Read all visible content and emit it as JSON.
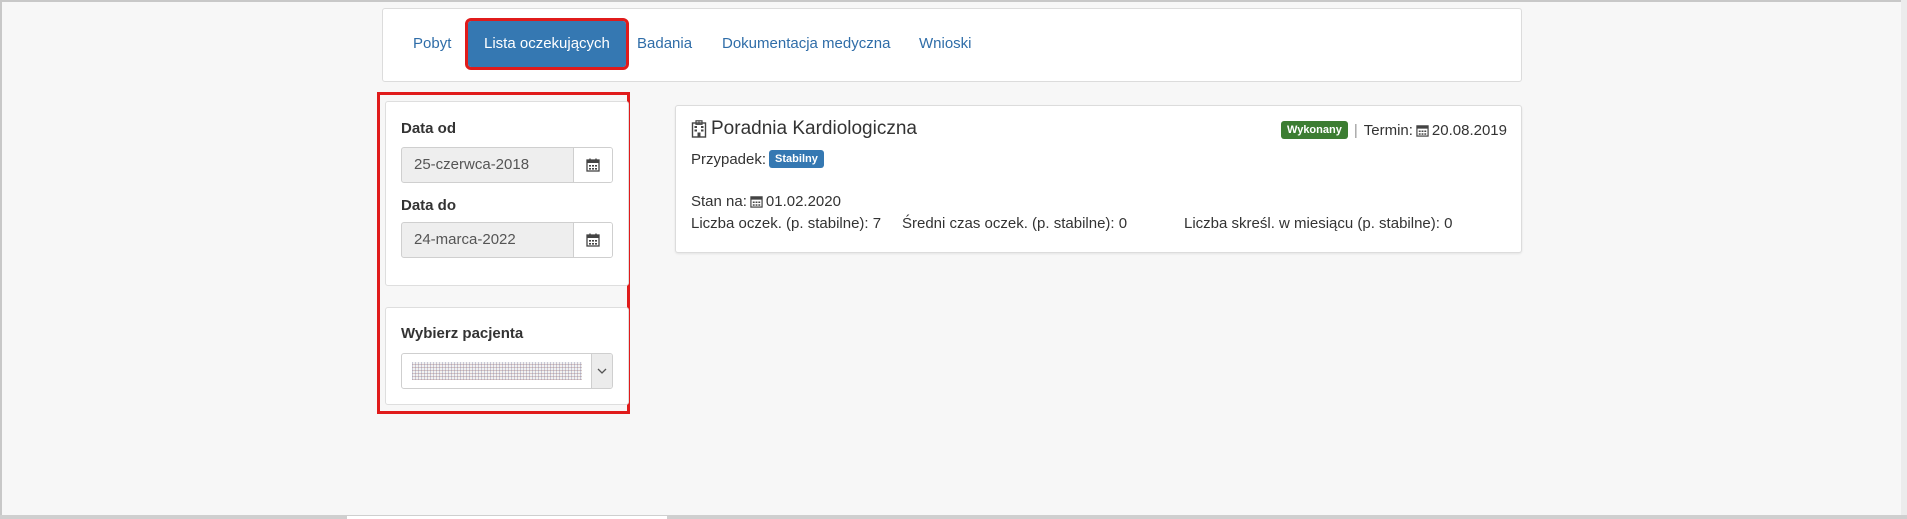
{
  "nav": {
    "tabs": [
      {
        "label": "Pobyt",
        "active": false
      },
      {
        "label": "Lista oczekujących",
        "active": true
      },
      {
        "label": "Badania",
        "active": false
      },
      {
        "label": "Dokumentacja medyczna",
        "active": false
      },
      {
        "label": "Wnioski",
        "active": false
      }
    ]
  },
  "filters": {
    "date_from": {
      "label": "Data od",
      "value": "25-czerwca-2018",
      "icon": "calendar-icon"
    },
    "date_to": {
      "label": "Data do",
      "value": "24-marca-2022",
      "icon": "calendar-icon"
    },
    "patient": {
      "label": "Wybierz pacjenta",
      "value_obscured": true,
      "icon": "chevron-down-icon"
    }
  },
  "clinic": {
    "name": "Poradnia Kardiologiczna",
    "icon": "hospital-icon",
    "status_badge": "Wykonany",
    "term_label": "Termin:",
    "term_date": "20.08.2019",
    "case_label": "Przypadek:",
    "case_badge": "Stabilny",
    "stan_label": "Stan na:",
    "stan_date": "01.02.2020",
    "stats": [
      {
        "label": "Liczba oczek. (p. stabilne): 7"
      },
      {
        "label": "Średni czas oczek. (p. stabilne): 0"
      },
      {
        "label": "Liczba skreśl. w miesiącu (p. stabilne): 0"
      }
    ]
  },
  "colors": {
    "accent": "#3578b2",
    "link": "#2f6da8",
    "highlight": "#e01b1b",
    "success_badge": "#3c7d32",
    "info_badge": "#3578b2"
  }
}
